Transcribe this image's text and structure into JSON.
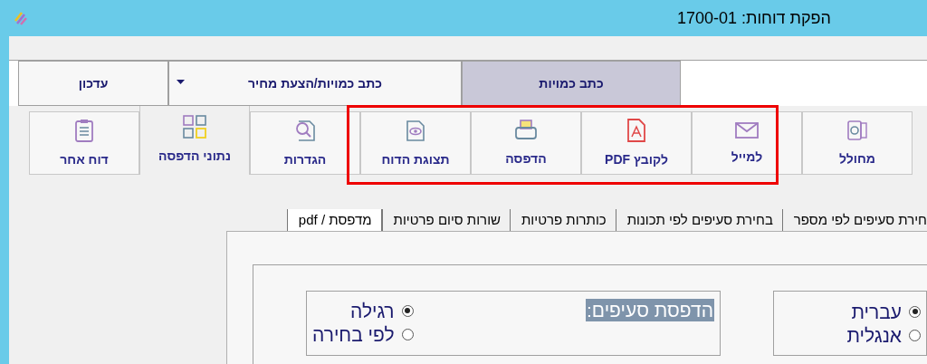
{
  "window": {
    "title": "הפקת דוחות: 1700-01"
  },
  "top_tabs": [
    {
      "label": "כתב כמויות",
      "kind": "tab",
      "selected": true
    },
    {
      "label": "כתב כמויות/הצעת מחיר",
      "kind": "dropdown",
      "selected": false
    },
    {
      "label": "עדכון",
      "kind": "tab",
      "selected": false
    }
  ],
  "toolbar": [
    {
      "label": "מחולל",
      "selected": false
    },
    {
      "label": "למייל",
      "selected": false
    },
    {
      "label": "לקובץ PDF",
      "selected": false
    },
    {
      "label": "הדפסה",
      "selected": false
    },
    {
      "label": "תצוגת הדוח",
      "selected": false
    },
    {
      "label": "הגדרות",
      "selected": false
    },
    {
      "label": "נתוני הדפסה",
      "selected": true
    },
    {
      "label": "דוח אחר",
      "selected": false
    }
  ],
  "sub_tabs": [
    {
      "label": "חירת סעיפים לפי מספר",
      "selected": false
    },
    {
      "label": "בחירת סעיפים לפי תכונות",
      "selected": false
    },
    {
      "label": "כותרות פרטיות",
      "selected": false
    },
    {
      "label": "שורות סיום פרטיות",
      "selected": false
    },
    {
      "label": "מדפסת / pdf",
      "selected": true
    }
  ],
  "language_options": [
    {
      "label": "עברית",
      "selected": true
    },
    {
      "label": "אנגלית",
      "selected": false
    }
  ],
  "item_printing": {
    "label": "הדפסת סעיפים:",
    "options": [
      {
        "label": "רגילה",
        "selected": true
      },
      {
        "label": "לפי בחירה",
        "selected": false
      }
    ]
  }
}
